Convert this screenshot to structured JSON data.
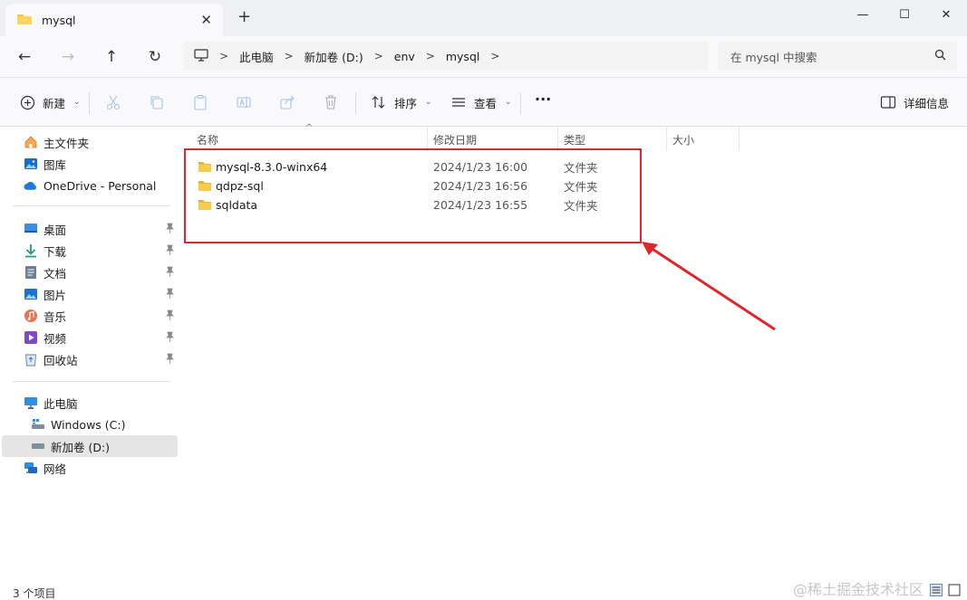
{
  "window": {
    "tab_title": "mysql",
    "tab_close": "✕",
    "new_tab": "+",
    "minimize": "—",
    "maximize": "☐",
    "close": "✕"
  },
  "nav": {
    "back": "←",
    "forward": "→",
    "up": "↑",
    "refresh": "↻",
    "separator": ">",
    "breadcrumbs": [
      "此电脑",
      "新加卷 (D:)",
      "env",
      "mysql"
    ],
    "search_placeholder": "在 mysql 中搜索"
  },
  "toolbar": {
    "new_label": "新建",
    "sort_label": "排序",
    "view_label": "查看",
    "more_label": "···",
    "details_label": "详细信息",
    "caret": "⌄"
  },
  "sidebar": {
    "quick": [
      {
        "label": "主文件夹",
        "icon": "home-icon"
      },
      {
        "label": "图库",
        "icon": "gallery-icon"
      },
      {
        "label": "OneDrive - Personal",
        "icon": "cloud-icon"
      }
    ],
    "pinned": [
      {
        "label": "桌面",
        "icon": "desktop-icon"
      },
      {
        "label": "下载",
        "icon": "download-icon"
      },
      {
        "label": "文档",
        "icon": "document-icon"
      },
      {
        "label": "图片",
        "icon": "picture-icon"
      },
      {
        "label": "音乐",
        "icon": "music-icon"
      },
      {
        "label": "视频",
        "icon": "video-icon"
      },
      {
        "label": "回收站",
        "icon": "recycle-bin-icon"
      }
    ],
    "pc": [
      {
        "label": "此电脑",
        "icon": "computer-icon"
      },
      {
        "label": "Windows (C:)",
        "icon": "drive-icon"
      },
      {
        "label": "新加卷 (D:)",
        "icon": "drive-icon",
        "selected": true
      },
      {
        "label": "网络",
        "icon": "network-icon"
      }
    ]
  },
  "columns": {
    "name": "名称",
    "modified": "修改日期",
    "type": "类型",
    "size": "大小",
    "sort_indicator": "^"
  },
  "files": [
    {
      "name": "mysql-8.3.0-winx64",
      "modified": "2024/1/23 16:00",
      "type": "文件夹"
    },
    {
      "name": "qdpz-sql",
      "modified": "2024/1/23 16:56",
      "type": "文件夹"
    },
    {
      "name": "sqldata",
      "modified": "2024/1/23 16:55",
      "type": "文件夹"
    }
  ],
  "status": {
    "item_count": "3 个项目",
    "watermark": "@稀土掘金技术社区"
  },
  "colors": {
    "accent": "#0067c0",
    "folder": "#f8c53a",
    "annotation": "#e0252b"
  }
}
